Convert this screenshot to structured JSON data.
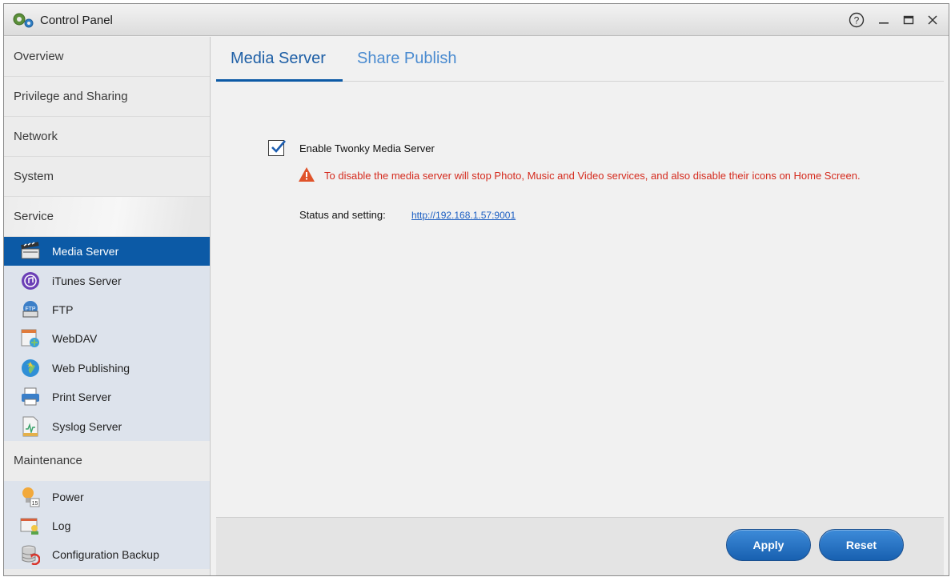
{
  "window": {
    "title": "Control Panel",
    "help_icon": "help-icon",
    "minimize_icon": "minimize-icon",
    "maximize_icon": "maximize-icon",
    "close_icon": "close-icon"
  },
  "sidebar": {
    "sections": [
      {
        "label": "Overview"
      },
      {
        "label": "Privilege and Sharing"
      },
      {
        "label": "Network"
      },
      {
        "label": "System"
      },
      {
        "label": "Service"
      },
      {
        "label": "Maintenance"
      }
    ],
    "service_items": [
      {
        "label": "Media Server",
        "icon": "media-server-icon",
        "active": true
      },
      {
        "label": "iTunes Server",
        "icon": "itunes-icon"
      },
      {
        "label": "FTP",
        "icon": "ftp-icon"
      },
      {
        "label": "WebDAV",
        "icon": "webdav-icon"
      },
      {
        "label": "Web Publishing",
        "icon": "web-publishing-icon"
      },
      {
        "label": "Print Server",
        "icon": "printer-icon"
      },
      {
        "label": "Syslog Server",
        "icon": "syslog-icon"
      }
    ],
    "maintenance_items": [
      {
        "label": "Power",
        "icon": "power-icon"
      },
      {
        "label": "Log",
        "icon": "log-icon"
      },
      {
        "label": "Configuration Backup",
        "icon": "database-icon"
      }
    ]
  },
  "tabs": [
    {
      "label": "Media Server",
      "active": true
    },
    {
      "label": "Share Publish",
      "active": false
    }
  ],
  "media_server": {
    "enable_label": "Enable Twonky Media Server",
    "enabled": true,
    "warning": "To disable the media server will stop Photo, Music and Video services, and also disable their icons on Home Screen.",
    "status_label": "Status and setting:",
    "status_link": "http://192.168.1.57:9001"
  },
  "footer": {
    "apply_label": "Apply",
    "reset_label": "Reset"
  },
  "colors": {
    "accent": "#0c5aa6",
    "warning": "#d52b1e",
    "link": "#1b5ec2"
  }
}
